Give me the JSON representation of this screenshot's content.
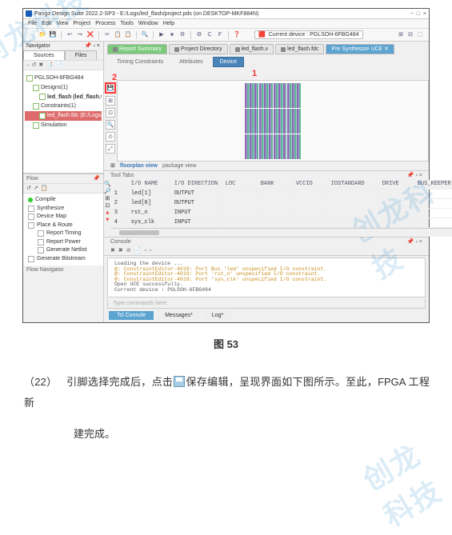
{
  "window": {
    "title": "Pango Design Suite 2022.2-SP3 - E:/Logs/led_flash/project.pds (on DESKTOP-MKF884N)",
    "minimize": "−",
    "maximize": "□",
    "close": "×"
  },
  "menu": {
    "items": [
      "File",
      "Edit",
      "View",
      "Project",
      "Process",
      "Tools",
      "Window",
      "Help"
    ]
  },
  "toolbar": {
    "icons": [
      "📄",
      "📁",
      "💾",
      "↩",
      "↪",
      "❌",
      "✂",
      "📋",
      "📋",
      "—",
      "🔍",
      "—",
      "▶",
      "⏹",
      "⚙",
      "—",
      "⚙",
      "C",
      "F",
      "—",
      "❓"
    ]
  },
  "device_bar": {
    "icon": "🟥",
    "label": "Current device : PGLSOH-6FBG484"
  },
  "navigator": {
    "title": "Navigator",
    "pin": "📌",
    "opts": "▫ ×",
    "tabs": [
      "Sources",
      "Files"
    ],
    "mini": [
      "⎯",
      "↺",
      "✖",
      "📑",
      "📄"
    ]
  },
  "tree": {
    "root": "PGLSOH-6FBG484",
    "design_label": "Designs(1)",
    "flash_label": "led_flash (led_flash.v)",
    "constraints_label": "Constraints(1)",
    "fdc_label": "led_flash.fdc (E:/Logs/led",
    "sim_label": "Simulation"
  },
  "flow": {
    "title": "Flow",
    "pin": "📌",
    "mini": [
      "↺",
      "↗",
      "📋"
    ],
    "items": [
      {
        "label": "Compile",
        "status": "green"
      },
      {
        "label": "Synthesize",
        "status": "none"
      },
      {
        "label": "Device Map",
        "status": "none"
      },
      {
        "label": "Place & Route",
        "status": "none"
      },
      {
        "label": "Report Timing",
        "status": "none",
        "indent": true
      },
      {
        "label": "Report Power",
        "status": "none",
        "indent": true
      },
      {
        "label": "Generate Netlist",
        "status": "none",
        "indent": true
      },
      {
        "label": "Generate Bitstream",
        "status": "none"
      }
    ],
    "bottom": "Flow Navigator"
  },
  "top_tabs": [
    {
      "label": "Report Summary",
      "icon": "📊"
    },
    {
      "label": "Project Directory",
      "icon": "📁"
    },
    {
      "label": "led_flash.v",
      "icon": "📄"
    },
    {
      "label": "led_flash.fdc",
      "icon": "📄"
    },
    {
      "label": "Pre Synthesize UCE ✕",
      "class": "blue"
    }
  ],
  "sub_tabs": {
    "items": [
      "Timing Constraints",
      "Attributes",
      "Device"
    ],
    "active": 2
  },
  "annotations": {
    "one": "1",
    "two": "2"
  },
  "fp_toolbar": {
    "save": "💾",
    "icons": [
      "⊞",
      "⊡",
      "🔍",
      "⊙",
      "⤢"
    ]
  },
  "floorplan": {
    "tabs": [
      "floorplan view",
      "package view"
    ],
    "active": 0
  },
  "tooltabs": {
    "title": "Tool Tabs",
    "pin": "📌",
    "opts": "▫ ×",
    "side_icons": [
      "🔍",
      "🔎",
      "⊞",
      "⊡",
      "🔺",
      "🔻"
    ]
  },
  "io_table": {
    "headers": [
      "",
      "I/O NAME",
      "I/O DIRECTION",
      "LOC",
      "BANK",
      "VCCIO",
      "IOSTANDARD",
      "DRIVE",
      "BUS_KEEPER"
    ],
    "rows": [
      {
        "idx": "1",
        "name": "led[1]",
        "dir": "OUTPUT"
      },
      {
        "idx": "2",
        "name": "led[0]",
        "dir": "OUTPUT"
      },
      {
        "idx": "3",
        "name": "rst_n",
        "dir": "INPUT"
      },
      {
        "idx": "4",
        "name": "sys_clk",
        "dir": "INPUT"
      }
    ]
  },
  "console": {
    "title": "Console",
    "pin": "📌",
    "opts": "▫ ×",
    "mini": [
      "✖",
      "✖",
      "⊘",
      "📄",
      "▫",
      "▫"
    ],
    "lines": [
      {
        "cls": "",
        "text": "Loading the device ..."
      },
      {
        "cls": "warn",
        "text": "@: ConstraintEditor-4019: Port Bus 'led' unspecified I/O constraint."
      },
      {
        "cls": "warn",
        "text": "@: ConstraintEditor-4019: Port 'rst_n' unspecified I/O constraint."
      },
      {
        "cls": "warn",
        "text": "@: ConstraintEditor-4019: Port 'sys_clk' unspecified I/O constraint."
      },
      {
        "cls": "",
        "text": "Open UCE successfully."
      },
      {
        "cls": "",
        "text": "Current device : PGLSOH-6FBG484"
      }
    ],
    "input_placeholder": "Type commands here.",
    "tabs": [
      "Tcl Console",
      "Messages*",
      "Log*"
    ]
  },
  "caption": "图 53",
  "step": {
    "no": "（22）",
    "text_a": "引脚选择完成后，点击",
    "text_b": "保存编辑，呈现界面如下图所示。至此，FPGA 工程新",
    "text_c": "建完成。"
  },
  "watermark": "创龙科技"
}
